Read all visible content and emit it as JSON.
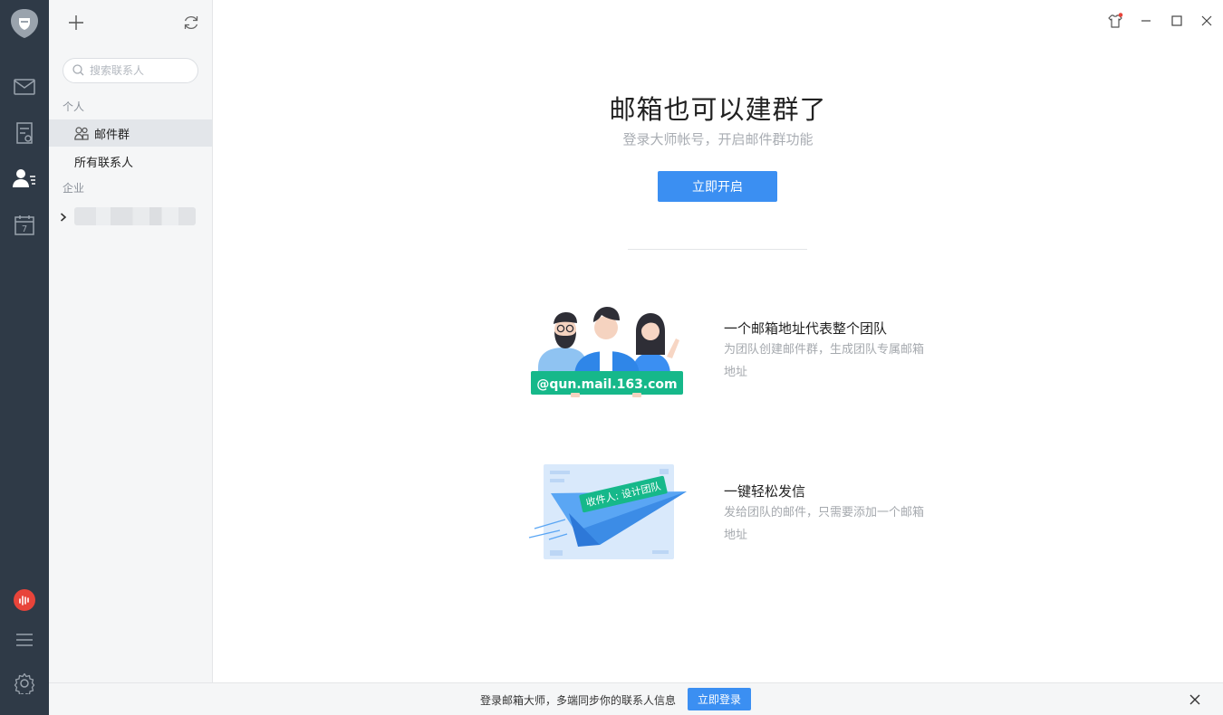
{
  "rail": {
    "icons": [
      "app-logo-icon",
      "mail-icon",
      "notes-icon",
      "contacts-icon",
      "calendar-icon",
      "podcast-icon",
      "menu-icon",
      "settings-icon"
    ],
    "calendar_day": "7",
    "accent_color": "#2f3a47"
  },
  "sidebar": {
    "search_placeholder": "搜索联系人",
    "section_personal": "个人",
    "item_mail_group": "邮件群",
    "item_all_contacts": "所有联系人",
    "section_enterprise": "企业"
  },
  "main": {
    "title": "邮箱也可以建群了",
    "subtitle": "登录大师帐号，开启邮件群功能",
    "cta_label": "立即开启",
    "features": [
      {
        "illustration_badge": "@qun.mail.163.com",
        "title": "一个邮箱地址代表整个团队",
        "desc": "为团队创建邮件群，生成团队专属邮箱地址"
      },
      {
        "illustration_badge": "收件人: 设计团队",
        "title": "一键轻松发信",
        "desc": "发给团队的邮件，只需要添加一个邮箱地址"
      }
    ]
  },
  "bottom_bar": {
    "message": "登录邮箱大师，多端同步你的联系人信息",
    "login_label": "立即登录"
  },
  "colors": {
    "primary": "#3b8ff2",
    "badge_green": "#16b88a",
    "notify_dot": "#e8443a"
  }
}
